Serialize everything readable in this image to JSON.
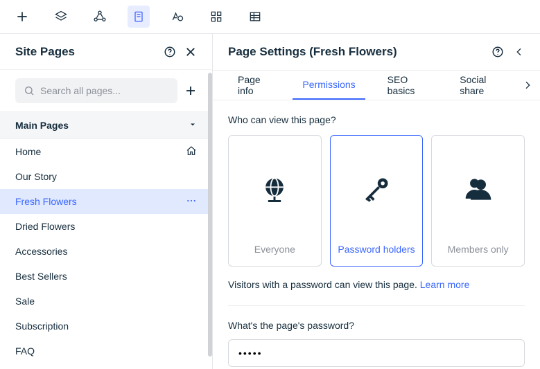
{
  "toolbar": {
    "items": [
      "add",
      "layers",
      "share-nodes",
      "page",
      "design",
      "apps",
      "table"
    ]
  },
  "sidebar": {
    "title": "Site Pages",
    "search_placeholder": "Search all pages...",
    "section_label": "Main Pages",
    "pages": [
      {
        "label": "Home",
        "trail": "home"
      },
      {
        "label": "Our Story",
        "trail": ""
      },
      {
        "label": "Fresh Flowers",
        "trail": "more",
        "selected": true
      },
      {
        "label": "Dried Flowers",
        "trail": ""
      },
      {
        "label": "Accessories",
        "trail": ""
      },
      {
        "label": "Best Sellers",
        "trail": ""
      },
      {
        "label": "Sale",
        "trail": ""
      },
      {
        "label": "Subscription",
        "trail": ""
      },
      {
        "label": "FAQ",
        "trail": ""
      }
    ]
  },
  "panel": {
    "title": "Page Settings (Fresh Flowers)",
    "tabs": [
      {
        "label": "Page info",
        "active": false
      },
      {
        "label": "Permissions",
        "active": true
      },
      {
        "label": "SEO basics",
        "active": false
      },
      {
        "label": "Social share",
        "active": false
      }
    ],
    "who_can_view_label": "Who can view this page?",
    "options": [
      {
        "key": "everyone",
        "label": "Everyone",
        "selected": false
      },
      {
        "key": "password",
        "label": "Password holders",
        "selected": true
      },
      {
        "key": "members",
        "label": "Members only",
        "selected": false
      }
    ],
    "helper_text_prefix": "Visitors with a password can view this page. ",
    "helper_link": "Learn more",
    "password_label": "What's the page's password?",
    "password_value": "•••••"
  }
}
